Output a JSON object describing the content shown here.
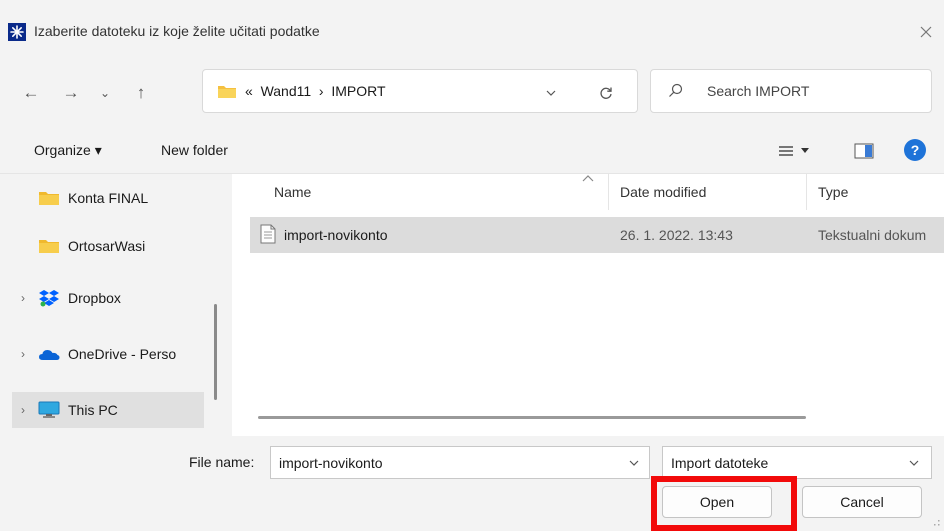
{
  "window": {
    "title": "Izaberite datoteku iz koje želite učitati podatke",
    "app_icon": "snowflake-app-icon",
    "close_glyph": "✕"
  },
  "nav": {
    "back_glyph": "←",
    "forward_glyph": "→",
    "recent_glyph": "⌄",
    "up_glyph": "↑",
    "address_text": "«  Wand11  ›  IMPORT",
    "search_placeholder": "Search IMPORT"
  },
  "toolbar": {
    "organize_label": "Organize ▾",
    "new_folder_label": "New folder",
    "help_glyph": "?"
  },
  "sidebar": {
    "items": [
      {
        "label": "Konta FINAL",
        "icon": "folder-icon",
        "chevron": ""
      },
      {
        "label": "OrtosarWasi",
        "icon": "folder-icon",
        "chevron": ""
      },
      {
        "label": "Dropbox",
        "icon": "dropbox-icon",
        "chevron": "›"
      },
      {
        "label": "OneDrive - Perso",
        "icon": "onedrive-icon",
        "chevron": "›"
      },
      {
        "label": "This PC",
        "icon": "monitor-icon",
        "chevron": "›"
      }
    ]
  },
  "columns": {
    "name": "Name",
    "date_modified": "Date modified",
    "type": "Type"
  },
  "files": [
    {
      "name": "import-novikonto",
      "date": "26. 1. 2022. 13:43",
      "type": "Tekstualni dokum"
    }
  ],
  "footer": {
    "file_name_label": "File name:",
    "file_name_value": "import-novikonto",
    "filter_value": "Import datoteke",
    "open_label": "Open",
    "cancel_label": "Cancel"
  },
  "colors": {
    "highlight": "#f20a0a",
    "chrome_bg": "#f3f3f3",
    "selection": "#dcdcdc",
    "folder": "#f5c040",
    "help_blue": "#1e73d8"
  }
}
